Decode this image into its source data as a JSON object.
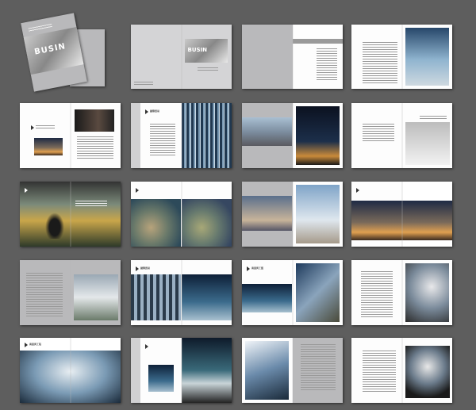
{
  "cover": {
    "title": "BUSIN"
  },
  "headings": {
    "h_r1c2": "BUSIN",
    "h_r2c2": "國際貿易",
    "h_r4c2": "國際貿易",
    "h_r4c3": "商業與工藝",
    "h_r5c1": "商業與工程"
  },
  "colors": {
    "background": "#5e5e5e",
    "page_grey": "#b9b9bb",
    "page_white": "#fdfdfd"
  }
}
